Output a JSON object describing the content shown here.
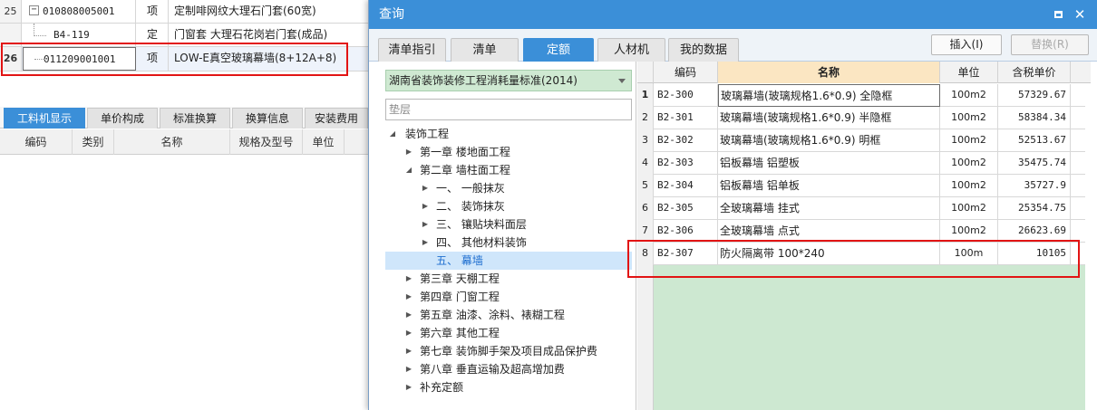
{
  "background_grid": {
    "rows": [
      {
        "num": "25",
        "code": "010808005001",
        "type": "项",
        "name": "定制啡网纹大理石门套(60宽)"
      },
      {
        "num": "",
        "code": "B4-119",
        "type": "定",
        "name": "门窗套 大理石花岗岩门套(成品)"
      },
      {
        "num": "26",
        "code": "011209001001",
        "type": "项",
        "name": "LOW-E真空玻璃幕墙(8+12A+8)"
      }
    ],
    "tabs": [
      "工料机显示",
      "单价构成",
      "标准换算",
      "换算信息",
      "安装费用"
    ],
    "columns": [
      "编码",
      "类别",
      "名称",
      "规格及型号",
      "单位"
    ]
  },
  "dialog": {
    "title": "查询",
    "tabs": [
      "清单指引",
      "清单",
      "定额",
      "人材机",
      "我的数据"
    ],
    "insert_button": "插入(I)",
    "replace_button": "替换(R)",
    "standard_select": "湖南省装饰装修工程消耗量标准(2014)",
    "search_placeholder": "垫层",
    "tree": [
      {
        "label": "装饰工程",
        "arrow": "◢"
      },
      {
        "label": "第一章 楼地面工程",
        "arrow": "▶"
      },
      {
        "label": "第二章 墙柱面工程",
        "arrow": "◢"
      },
      {
        "label": "一、  一般抹灰",
        "arrow": "▶"
      },
      {
        "label": "二、  装饰抹灰",
        "arrow": "▶"
      },
      {
        "label": "三、  镶贴块料面层",
        "arrow": "▶"
      },
      {
        "label": "四、  其他材料装饰",
        "arrow": "▶"
      },
      {
        "label": "五、  幕墙",
        "arrow": ""
      },
      {
        "label": "第三章 天棚工程",
        "arrow": "▶"
      },
      {
        "label": "第四章 门窗工程",
        "arrow": "▶"
      },
      {
        "label": "第五章 油漆、涂料、裱糊工程",
        "arrow": "▶"
      },
      {
        "label": "第六章 其他工程",
        "arrow": "▶"
      },
      {
        "label": "第七章 装饰脚手架及项目成品保护费",
        "arrow": "▶"
      },
      {
        "label": "第八章 垂直运输及超高增加费",
        "arrow": "▶"
      },
      {
        "label": "补充定额",
        "arrow": "▶"
      }
    ],
    "table": {
      "headers": [
        "编码",
        "名称",
        "单位",
        "含税单价"
      ],
      "rows": [
        {
          "num": "1",
          "code": "B2-300",
          "name": "玻璃幕墙(玻璃规格1.6*0.9) 全隐框",
          "unit": "100m2",
          "price": "57329.67"
        },
        {
          "num": "2",
          "code": "B2-301",
          "name": "玻璃幕墙(玻璃规格1.6*0.9) 半隐框",
          "unit": "100m2",
          "price": "58384.34"
        },
        {
          "num": "3",
          "code": "B2-302",
          "name": "玻璃幕墙(玻璃规格1.6*0.9) 明框",
          "unit": "100m2",
          "price": "52513.67"
        },
        {
          "num": "4",
          "code": "B2-303",
          "name": "铝板幕墙 铝塑板",
          "unit": "100m2",
          "price": "35475.74"
        },
        {
          "num": "5",
          "code": "B2-304",
          "name": "铝板幕墙 铝单板",
          "unit": "100m2",
          "price": "35727.9"
        },
        {
          "num": "6",
          "code": "B2-305",
          "name": "全玻璃幕墙 挂式",
          "unit": "100m2",
          "price": "25354.75"
        },
        {
          "num": "7",
          "code": "B2-306",
          "name": "全玻璃幕墙 点式",
          "unit": "100m2",
          "price": "26623.69"
        },
        {
          "num": "8",
          "code": "B2-307",
          "name": "防火隔离带 100*240",
          "unit": "100m",
          "price": "10105"
        }
      ]
    }
  }
}
